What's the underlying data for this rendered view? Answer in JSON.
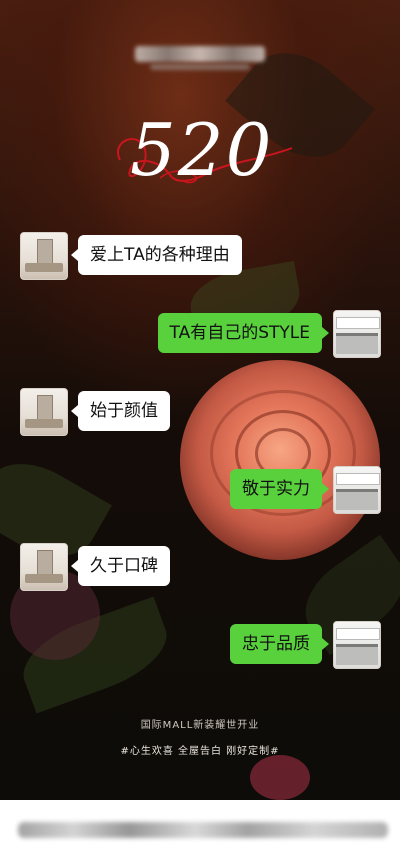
{
  "header": {
    "big_number": "520",
    "script_word": "Love"
  },
  "messages": [
    {
      "text": "爱上TA的各种理由",
      "side": "left"
    },
    {
      "text": "TA有自己的STYLE",
      "side": "right"
    },
    {
      "text": "始于颜值",
      "side": "left"
    },
    {
      "text": "敬于实力",
      "side": "right"
    },
    {
      "text": "久于口碑",
      "side": "left"
    },
    {
      "text": "忠于品质",
      "side": "right"
    }
  ],
  "footer": {
    "line1": "国际MALL新装耀世开业",
    "line2": "#心生欢喜  全屋告白  刚好定制#"
  },
  "colors": {
    "bubble_green": "#59d13d",
    "bubble_white": "#ffffff",
    "script_red": "#c9151e"
  }
}
